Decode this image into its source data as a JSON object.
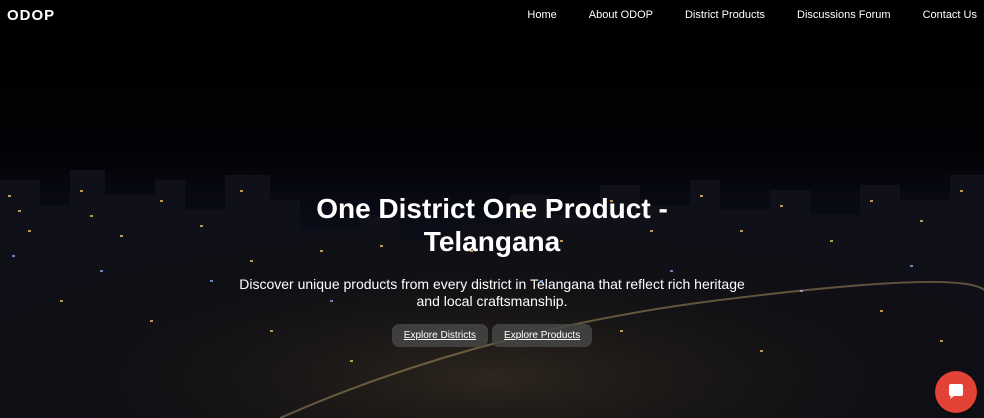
{
  "brand": "ODOP",
  "nav": {
    "items": [
      "Home",
      "About ODOP",
      "District Products",
      "Discussions Forum",
      "Contact Us"
    ]
  },
  "hero": {
    "title": "One District One Product - Telangana",
    "description": "Discover unique products from every district in Telangana that reflect rich heritage and local craftsmanship.",
    "buttons": [
      "Explore Districts",
      "Explore Products"
    ]
  },
  "icons": {
    "chat": "chat-bubble-icon",
    "background": "city-night-skyline"
  },
  "colors": {
    "chat_button": "#e24336",
    "text": "#ffffff",
    "hero_button_bg": "#464646"
  }
}
